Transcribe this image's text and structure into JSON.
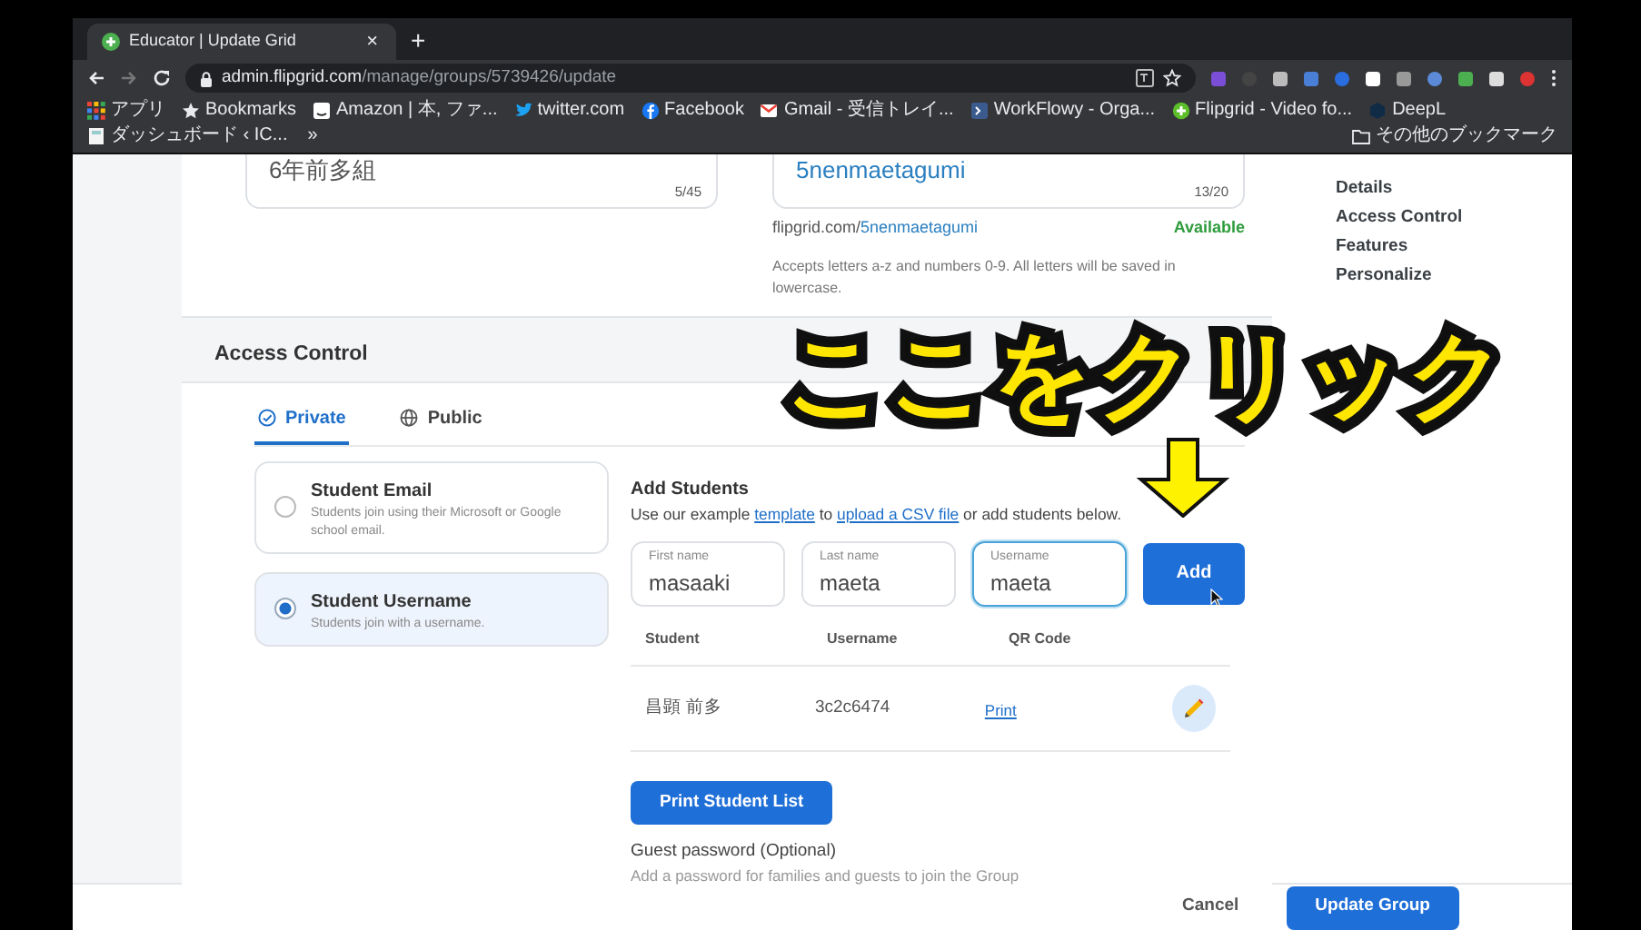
{
  "browser": {
    "tab_title": "Educator | Update Grid",
    "tab_close": "×",
    "new_tab": "+",
    "url_host": "admin.flipgrid.com",
    "url_path": "/manage/groups/5739426/update",
    "bookmarks": [
      {
        "label": "アプリ",
        "kind": "apps"
      },
      {
        "label": "Bookmarks",
        "kind": "star"
      },
      {
        "label": "Amazon | 本, ファ...",
        "kind": "square"
      },
      {
        "label": "twitter.com",
        "kind": "bird"
      },
      {
        "label": "Facebook",
        "kind": "circle_blue"
      },
      {
        "label": "Gmail - 受信トレイ...",
        "kind": "envelope"
      },
      {
        "label": "WorkFlowy - Orga...",
        "kind": "square_blue"
      },
      {
        "label": "Flipgrid - Video fo...",
        "kind": "circle_green"
      },
      {
        "label": "DeepL",
        "kind": "hexagon"
      },
      {
        "label": "ダッシュボード ‹ IC...",
        "kind": "page"
      },
      {
        "label": "»",
        "kind": "more"
      },
      {
        "label": "その他のブックマーク",
        "kind": "folder"
      }
    ]
  },
  "group_fields": [
    {
      "kind": "name",
      "value": "6年前多組",
      "counter": "5/45"
    },
    {
      "kind": "code",
      "value": "5nenmaetagumi",
      "counter": "13/20"
    }
  ],
  "flip_link": {
    "prefix": "flipgrid.com/",
    "code": "5nenmaetagumi",
    "status": "Available",
    "hint": "Accepts letters a-z and numbers 0-9. All letters will be saved in lowercase."
  },
  "section_nav": [
    {
      "label": "Details"
    },
    {
      "label": "Access Control"
    },
    {
      "label": "Features"
    },
    {
      "label": "Personalize"
    }
  ],
  "access_control": {
    "title": "Access Control",
    "tabs": [
      {
        "label": "Private",
        "kind": "private",
        "selected": true
      },
      {
        "label": "Public",
        "kind": "public",
        "selected": false
      }
    ],
    "options": [
      {
        "title": "Student Email",
        "description": "Students join using their Microsoft or Google school email.",
        "selected": false
      },
      {
        "title": "Student Username",
        "description": "Students join with a username.",
        "selected": true
      }
    ],
    "add_students": {
      "title": "Add Students",
      "instructions": [
        {
          "text": "Use our example ",
          "link": false
        },
        {
          "text": "template",
          "link": true
        },
        {
          "text": " to ",
          "link": false
        },
        {
          "text": "upload a CSV file",
          "link": true
        },
        {
          "text": " or add students below.",
          "link": false
        }
      ],
      "fields": [
        {
          "label": "First name",
          "value": "masaaki",
          "focused": false
        },
        {
          "label": "Last name",
          "value": "maeta",
          "focused": false
        },
        {
          "label": "Username",
          "value": "maeta",
          "focused": true
        }
      ],
      "add_button": "Add"
    },
    "table": {
      "columns": [
        "Student",
        "Username",
        "QR Code"
      ],
      "rows": [
        {
          "student": "昌顕 前多",
          "username": "3c2c6474",
          "qr": "Print"
        }
      ]
    },
    "print_button": "Print Student List",
    "guest_password": {
      "label": "Guest password (Optional)",
      "description": "Add a password for families and guests to join the Group"
    }
  },
  "footer": {
    "cancel": "Cancel",
    "update": "Update Group"
  },
  "overlay": {
    "caption": "ここをクリック"
  }
}
